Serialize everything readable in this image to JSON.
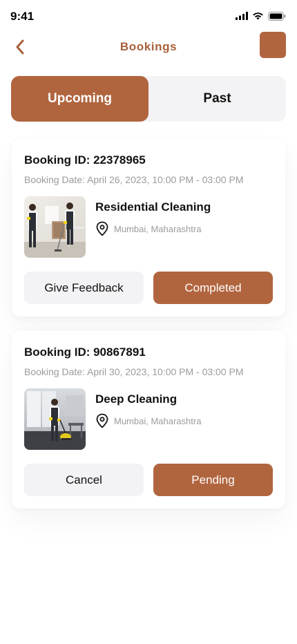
{
  "status_bar": {
    "time": "9:41"
  },
  "header": {
    "title": "Bookings"
  },
  "tabs": [
    {
      "label": "Upcoming",
      "active": true
    },
    {
      "label": "Past",
      "active": false
    }
  ],
  "bookings": [
    {
      "id_label": "Booking ID: 22378965",
      "date_label": "Booking Date: April 26, 2023, 10:00 PM - 03:00 PM",
      "service": "Residential Cleaning",
      "location": "Mumbai, Maharashtra",
      "secondary_action": "Give Feedback",
      "status": "Completed"
    },
    {
      "id_label": "Booking ID: 90867891",
      "date_label": "Booking Date: April 30, 2023, 10:00 PM - 03:00 PM",
      "service": "Deep Cleaning",
      "location": "Mumbai, Maharashtra",
      "secondary_action": "Cancel",
      "status": "Pending"
    }
  ],
  "colors": {
    "accent": "#b1653f",
    "title": "#a8603a",
    "muted_text": "#9b9b9b",
    "surface": "#f3f3f5"
  },
  "icons": {
    "back": "chevron-left-icon",
    "location": "map-pin-icon",
    "signal": "cellular-signal-icon",
    "wifi": "wifi-icon",
    "battery": "battery-icon"
  }
}
